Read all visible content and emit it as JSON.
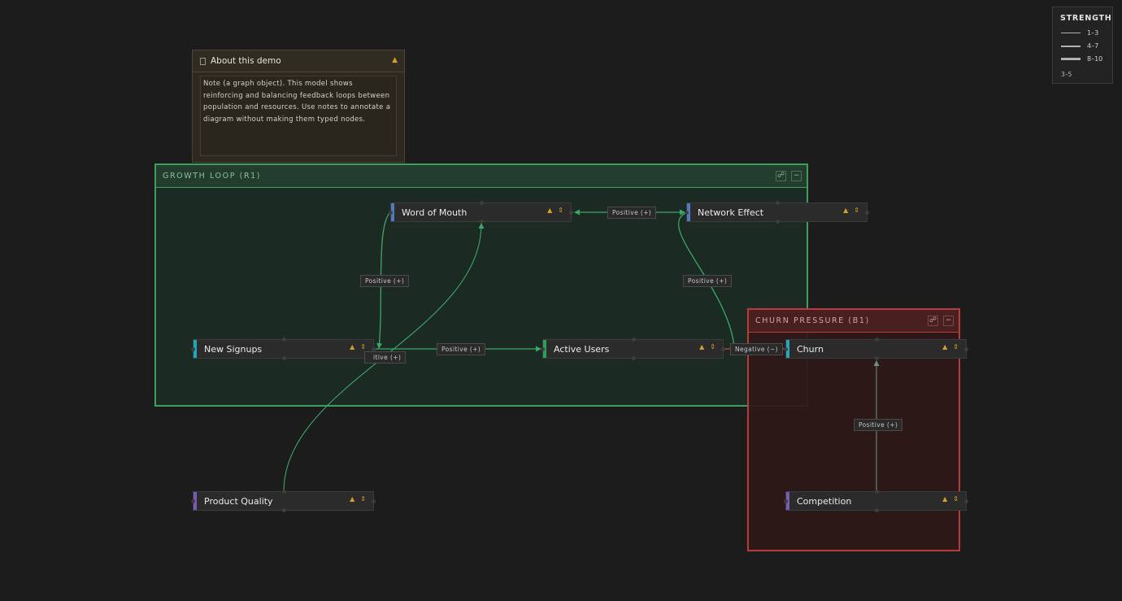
{
  "legend": {
    "title": "STRENGTH",
    "items": [
      {
        "label": "1–3"
      },
      {
        "label": "4–7"
      },
      {
        "label": "8–10"
      }
    ],
    "extra": "3–5"
  },
  "note": {
    "title": "About this demo",
    "body": "Note (a graph object). This model shows reinforcing and balancing feedback loops between population and resources. Use notes to annotate a diagram without making them typed nodes.",
    "icon": "document-icon",
    "pin_icon": "pin-icon"
  },
  "groups": {
    "growth": {
      "title": "GROWTH LOOP (R1)",
      "color": "#3e9e5f"
    },
    "churn": {
      "title": "CHURN PRESSURE (B1)",
      "color": "#b83a3a"
    }
  },
  "nodes": {
    "word_of_mouth": {
      "label": "Word of Mouth",
      "color": "#4f7ac0"
    },
    "network_effect": {
      "label": "Network Effect",
      "color": "#4f7ac0"
    },
    "new_signups": {
      "label": "New Signups",
      "color": "#1fa9b8"
    },
    "active_users": {
      "label": "Active Users",
      "color": "#2e9e5b"
    },
    "churn": {
      "label": "Churn",
      "color": "#1fa9b8"
    },
    "product_quality": {
      "label": "Product Quality",
      "color": "#7a5ab5"
    },
    "competition": {
      "label": "Competition",
      "color": "#7a5ab5"
    }
  },
  "edges": {
    "wom_network": {
      "label": "Positive (+)"
    },
    "wom_signups": {
      "label": "Positive (+)"
    },
    "network_active": {
      "label": "Positive (+)"
    },
    "signups_active": {
      "label": "Positive (+)"
    },
    "quality_wom": {
      "label": "itive (+)"
    },
    "active_churn": {
      "label": "Negative (−)"
    },
    "competition_churn": {
      "label": "Positive (+)"
    }
  },
  "colors": {
    "positive_edge": "#3aa866",
    "negative_edge": "#c24a3a",
    "neutral_edge": "#6e8f78"
  }
}
